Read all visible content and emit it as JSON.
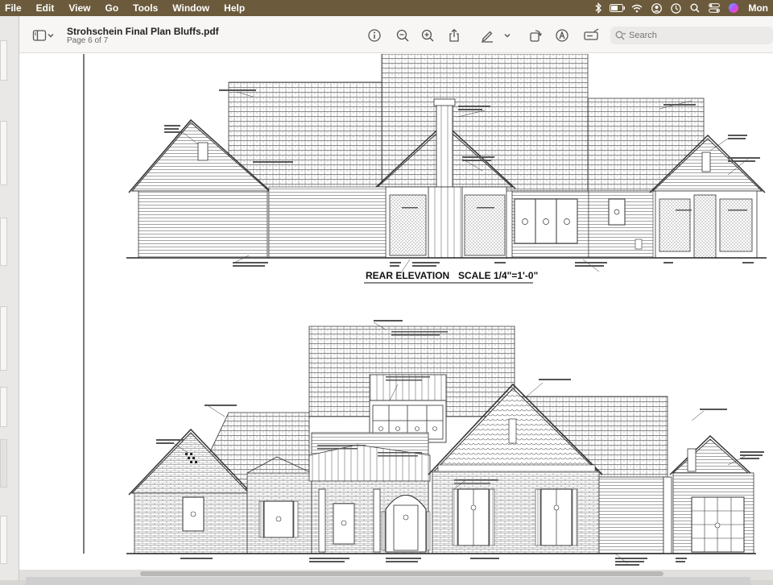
{
  "menubar": {
    "items": [
      "File",
      "Edit",
      "View",
      "Go",
      "Tools",
      "Window",
      "Help"
    ],
    "clock": "Mon",
    "status_icons": [
      "bluetooth-icon",
      "battery-icon",
      "wifi-icon",
      "user-icon",
      "clock-icon",
      "search-icon",
      "control-center-icon",
      "siri-icon"
    ]
  },
  "toolbar": {
    "title": "Strohschein Final Plan Bluffs.pdf",
    "subtitle": "Page 6 of 7",
    "search_placeholder": "Search",
    "icons": [
      "sidebar-icon",
      "chevron-down-icon",
      "info-icon",
      "zoom-out-icon",
      "zoom-in-icon",
      "share-icon",
      "highlight-icon",
      "chevron-down-icon",
      "rotate-icon",
      "markup-icon",
      "form-fill-icon",
      "search-icon"
    ]
  },
  "document": {
    "rear_elevation_label": "REAR ELEVATION",
    "scale_label": "SCALE 1/4\"=1'-0\""
  },
  "colors": {
    "menubar": "#6b5a3c",
    "toolbar": "#f7f6f5",
    "page": "#ffffff"
  }
}
